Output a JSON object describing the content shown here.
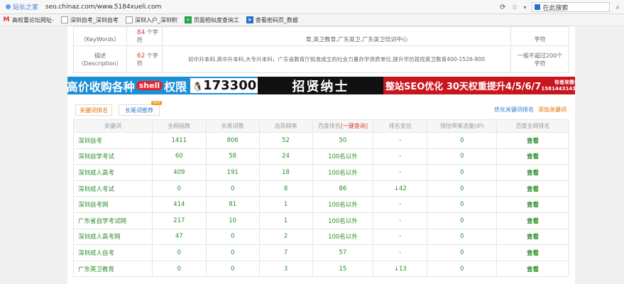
{
  "browser": {
    "site_title": "站长之家",
    "url": "seo.chinaz.com/www.5184xueli.com",
    "search_placeholder": "在此搜索"
  },
  "bookmarks": [
    {
      "label": "高权重论坛网址-",
      "icon": "M",
      "color": "#d9352b"
    },
    {
      "label": "深圳自考_深圳自考",
      "icon": "page",
      "color": "#888888"
    },
    {
      "label": "深圳入户_深圳积",
      "icon": "page",
      "color": "#888888"
    },
    {
      "label": "页面相似度查询工",
      "icon": "plus",
      "color": "#2aa04a"
    },
    {
      "label": "查看密码页_数据",
      "icon": "arrow",
      "color": "#2a6fc8"
    }
  ],
  "meta": {
    "keywords": {
      "label": "（KeyWords）",
      "count": "84",
      "unit": "个字符",
      "content": "育,英卫教育,广东英卫,广东英卫培训中心",
      "limit": "字符"
    },
    "desc": {
      "label1": "描述",
      "label2": "（Description）",
      "count": "62",
      "unit": "个字符",
      "content": "初中升本科,高中升本科,大专升本科，广东省教育厅批准成立的社会力量办学资质单位,提升学历就找英卫教育400-1526-800",
      "limit1": "一般不超过200个",
      "limit2": "字符"
    }
  },
  "banners": {
    "b1_text": "高价收购各种",
    "b1_shell": "shell",
    "b1_suffix": "权限",
    "b1_qq": "173300",
    "b2_text": "招贤纳士",
    "b3_text": "整站SEO优化  30天权重提升4/5/6/7",
    "b3_contact1": "有者来微信",
    "b3_contact2": "15814431439"
  },
  "tabs": {
    "tab1": "关键词排名",
    "tab2": "长尾词推荐",
    "hot": "HOT",
    "link_optimize": "优化关键词排名",
    "link_add": "添加关键词"
  },
  "table": {
    "headers": [
      "关键词",
      "全网指数",
      "长尾词数",
      "出现频率",
      "百度排名",
      "排名变化",
      "预估带来流量(IP)",
      "百度全网排名"
    ],
    "query_label": "[一键查询]",
    "rows": [
      {
        "kw": "深圳自考",
        "index": "1411",
        "long": "806",
        "freq": "52",
        "rank": "50",
        "change": "-",
        "change_type": "none",
        "ip": "0",
        "view": "查看"
      },
      {
        "kw": "深圳自学考试",
        "index": "60",
        "long": "58",
        "freq": "24",
        "rank": "100名以外",
        "change": "-",
        "change_type": "none",
        "ip": "0",
        "view": "查看"
      },
      {
        "kw": "深圳成人高考",
        "index": "409",
        "long": "191",
        "freq": "18",
        "rank": "100名以外",
        "change": "-",
        "change_type": "none",
        "ip": "0",
        "view": "查看"
      },
      {
        "kw": "深圳成人考试",
        "index": "0",
        "long": "0",
        "freq": "8",
        "rank": "86",
        "change": "↓42",
        "change_type": "down",
        "ip": "0",
        "view": "查看"
      },
      {
        "kw": "深圳自考网",
        "index": "414",
        "long": "81",
        "freq": "1",
        "rank": "100名以外",
        "change": "-",
        "change_type": "none",
        "ip": "0",
        "view": "查看"
      },
      {
        "kw": "广东省自学考试网",
        "index": "217",
        "long": "10",
        "freq": "1",
        "rank": "100名以外",
        "change": "-",
        "change_type": "none",
        "ip": "0",
        "view": "查看"
      },
      {
        "kw": "深圳成人高考网",
        "index": "47",
        "long": "0",
        "freq": "2",
        "rank": "100名以外",
        "change": "-",
        "change_type": "none",
        "ip": "0",
        "view": "查看"
      },
      {
        "kw": "深圳成人自考",
        "index": "0",
        "long": "0",
        "freq": "7",
        "rank": "57",
        "change": "-",
        "change_type": "none",
        "ip": "0",
        "view": "查看"
      },
      {
        "kw": "广东英卫教育",
        "index": "0",
        "long": "0",
        "freq": "3",
        "rank": "15",
        "change": "↓13",
        "change_type": "down",
        "ip": "0",
        "view": "查看"
      }
    ]
  }
}
